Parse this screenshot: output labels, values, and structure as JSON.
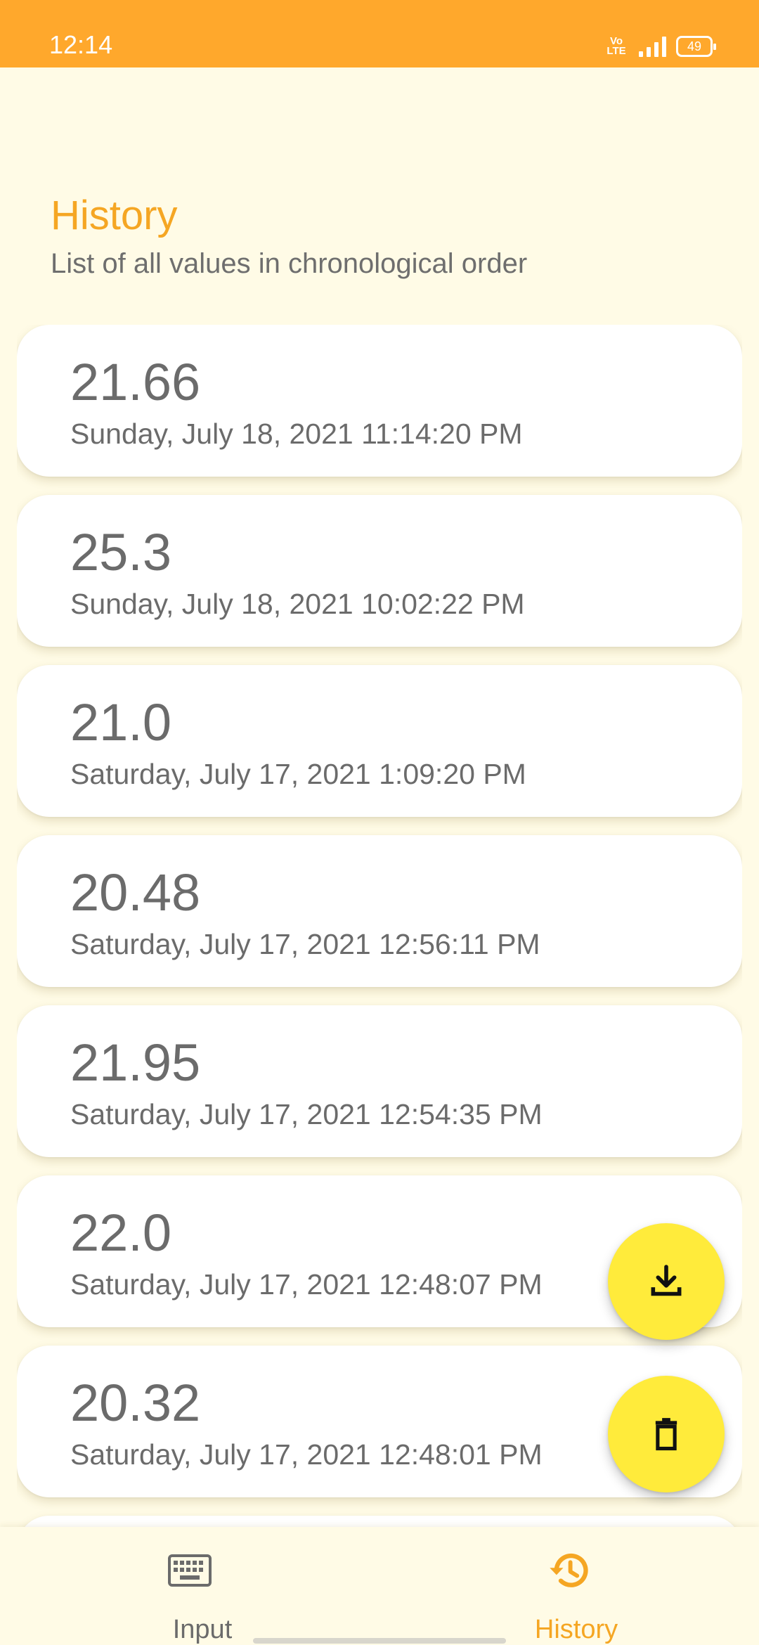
{
  "status_bar": {
    "time": "12:14",
    "volte_top": "Vo",
    "volte_bottom": "LTE",
    "battery": "49",
    "bg_color": "#FFA82C"
  },
  "header": {
    "title": "History",
    "subtitle": "List of all values in chronological order"
  },
  "history": [
    {
      "value": "21.66",
      "date": "Sunday, July 18, 2021 11:14:20 PM"
    },
    {
      "value": "25.3",
      "date": "Sunday, July 18, 2021 10:02:22 PM"
    },
    {
      "value": "21.0",
      "date": "Saturday, July 17, 2021 1:09:20 PM"
    },
    {
      "value": "20.48",
      "date": "Saturday, July 17, 2021 12:56:11 PM"
    },
    {
      "value": "21.95",
      "date": "Saturday, July 17, 2021 12:54:35 PM"
    },
    {
      "value": "22.0",
      "date": "Saturday, July 17, 2021 12:48:07 PM"
    },
    {
      "value": "20.32",
      "date": "Saturday, July 17, 2021 12:48:01 PM"
    }
  ],
  "fabs": {
    "download_icon": "download-icon",
    "delete_icon": "trash-icon"
  },
  "bottom_nav": {
    "items": [
      {
        "label": "Input",
        "icon": "keyboard-icon",
        "active": false
      },
      {
        "label": "History",
        "icon": "history-icon",
        "active": true
      }
    ]
  },
  "colors": {
    "accent": "#F5A623",
    "background": "#FFFBE6",
    "fab": "#FFEB3B",
    "card": "#FFFFFF",
    "text": "#6B6B6B"
  }
}
